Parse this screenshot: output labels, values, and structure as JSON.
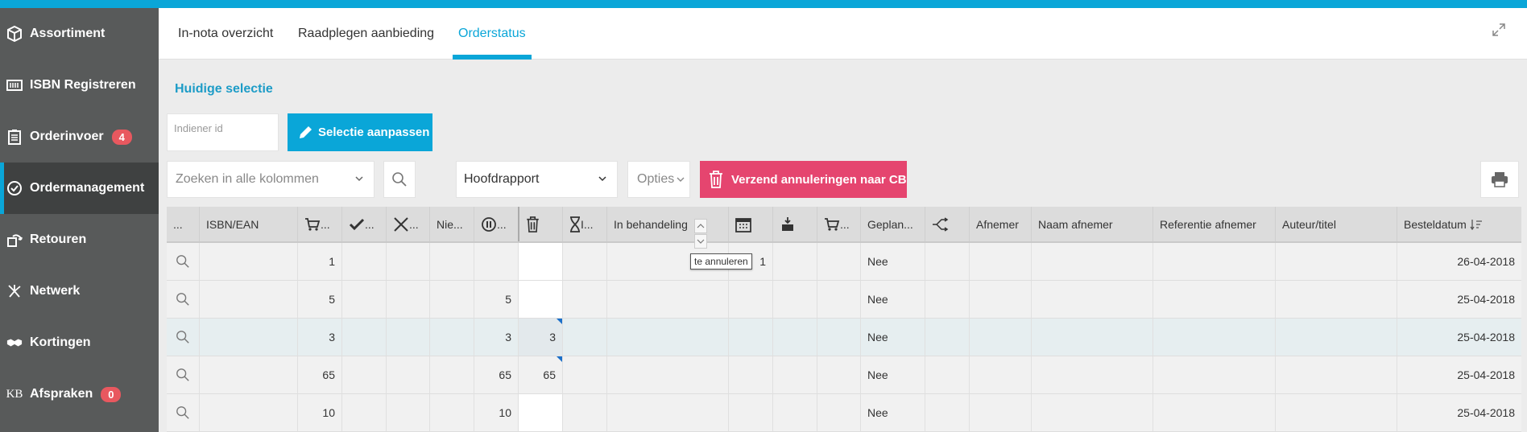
{
  "sidebar": {
    "items": [
      {
        "label": "Assortiment",
        "icon": "package-icon"
      },
      {
        "label": "ISBN Registreren",
        "icon": "barcode-icon"
      },
      {
        "label": "Orderinvoer",
        "icon": "clipboard-icon",
        "badge": "4"
      },
      {
        "label": "Ordermanagement",
        "icon": "check-circle-icon",
        "active": true
      },
      {
        "label": "Retouren",
        "icon": "return-icon"
      },
      {
        "label": "Netwerk",
        "icon": "network-icon"
      },
      {
        "label": "Kortingen",
        "icon": "handshake-icon"
      },
      {
        "label": "Afspraken",
        "icon": "kb-icon",
        "badge": "0"
      }
    ]
  },
  "tabs": [
    "In-nota overzicht",
    "Raadplegen aanbieding",
    "Orderstatus"
  ],
  "selection": {
    "title": "Huidige selectie",
    "indiener_label": "Indiener id",
    "edit_button": "Selectie aanpassen"
  },
  "toolbar": {
    "search_placeholder": "Zoeken in alle kolommen",
    "report": "Hoofdrapport",
    "opties": "Opties",
    "cancel_button": "Verzend annuleringen naar CB"
  },
  "table": {
    "headers": [
      "...",
      "ISBN/EAN",
      "...",
      "...",
      "...",
      "Nie...",
      "...",
      "",
      "I...",
      "In behandeling",
      "",
      "",
      "...",
      "Geplan...",
      "",
      "Afnemer",
      "Naam afnemer",
      "Referentie afnemer",
      "Auteur/titel",
      "Besteldatum"
    ],
    "rows": [
      {
        "c1": "1",
        "c5": "",
        "c6": "",
        "c9": "1",
        "plan": "Nee",
        "date": "26-04-2018"
      },
      {
        "c1": "5",
        "c5": "5",
        "c6": "",
        "c9": "",
        "plan": "Nee",
        "date": "25-04-2018"
      },
      {
        "c1": "3",
        "c5": "3",
        "c6": "3",
        "c9": "",
        "plan": "Nee",
        "date": "25-04-2018"
      },
      {
        "c1": "65",
        "c5": "65",
        "c6": "65",
        "c9": "",
        "plan": "Nee",
        "date": "25-04-2018"
      },
      {
        "c1": "10",
        "c5": "10",
        "c6": "",
        "c9": "",
        "plan": "Nee",
        "date": "25-04-2018"
      }
    ],
    "tooltip": "te annuleren"
  },
  "colors": {
    "accent": "#0aa6d8",
    "danger": "#e5456f",
    "sidebar": "#585a5a",
    "badge": "#e8585f"
  }
}
